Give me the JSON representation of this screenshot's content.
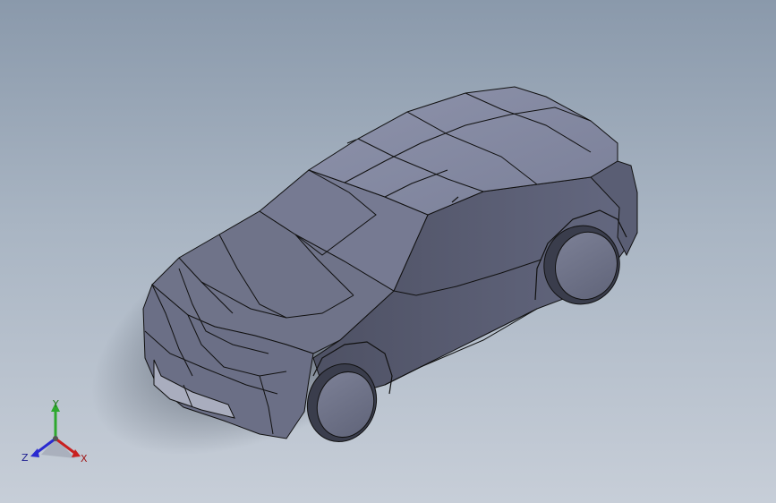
{
  "viewport": {
    "background_top": "#8a99ab",
    "background_bottom": "#c7ced8",
    "model_color": "#6d7187",
    "edge_color": "#111111"
  },
  "triad": {
    "y_label": "Y",
    "x_label": "X",
    "z_label": "Z",
    "y_color": "#2ea82e",
    "x_color": "#c82020",
    "z_color": "#2a2ad0"
  }
}
